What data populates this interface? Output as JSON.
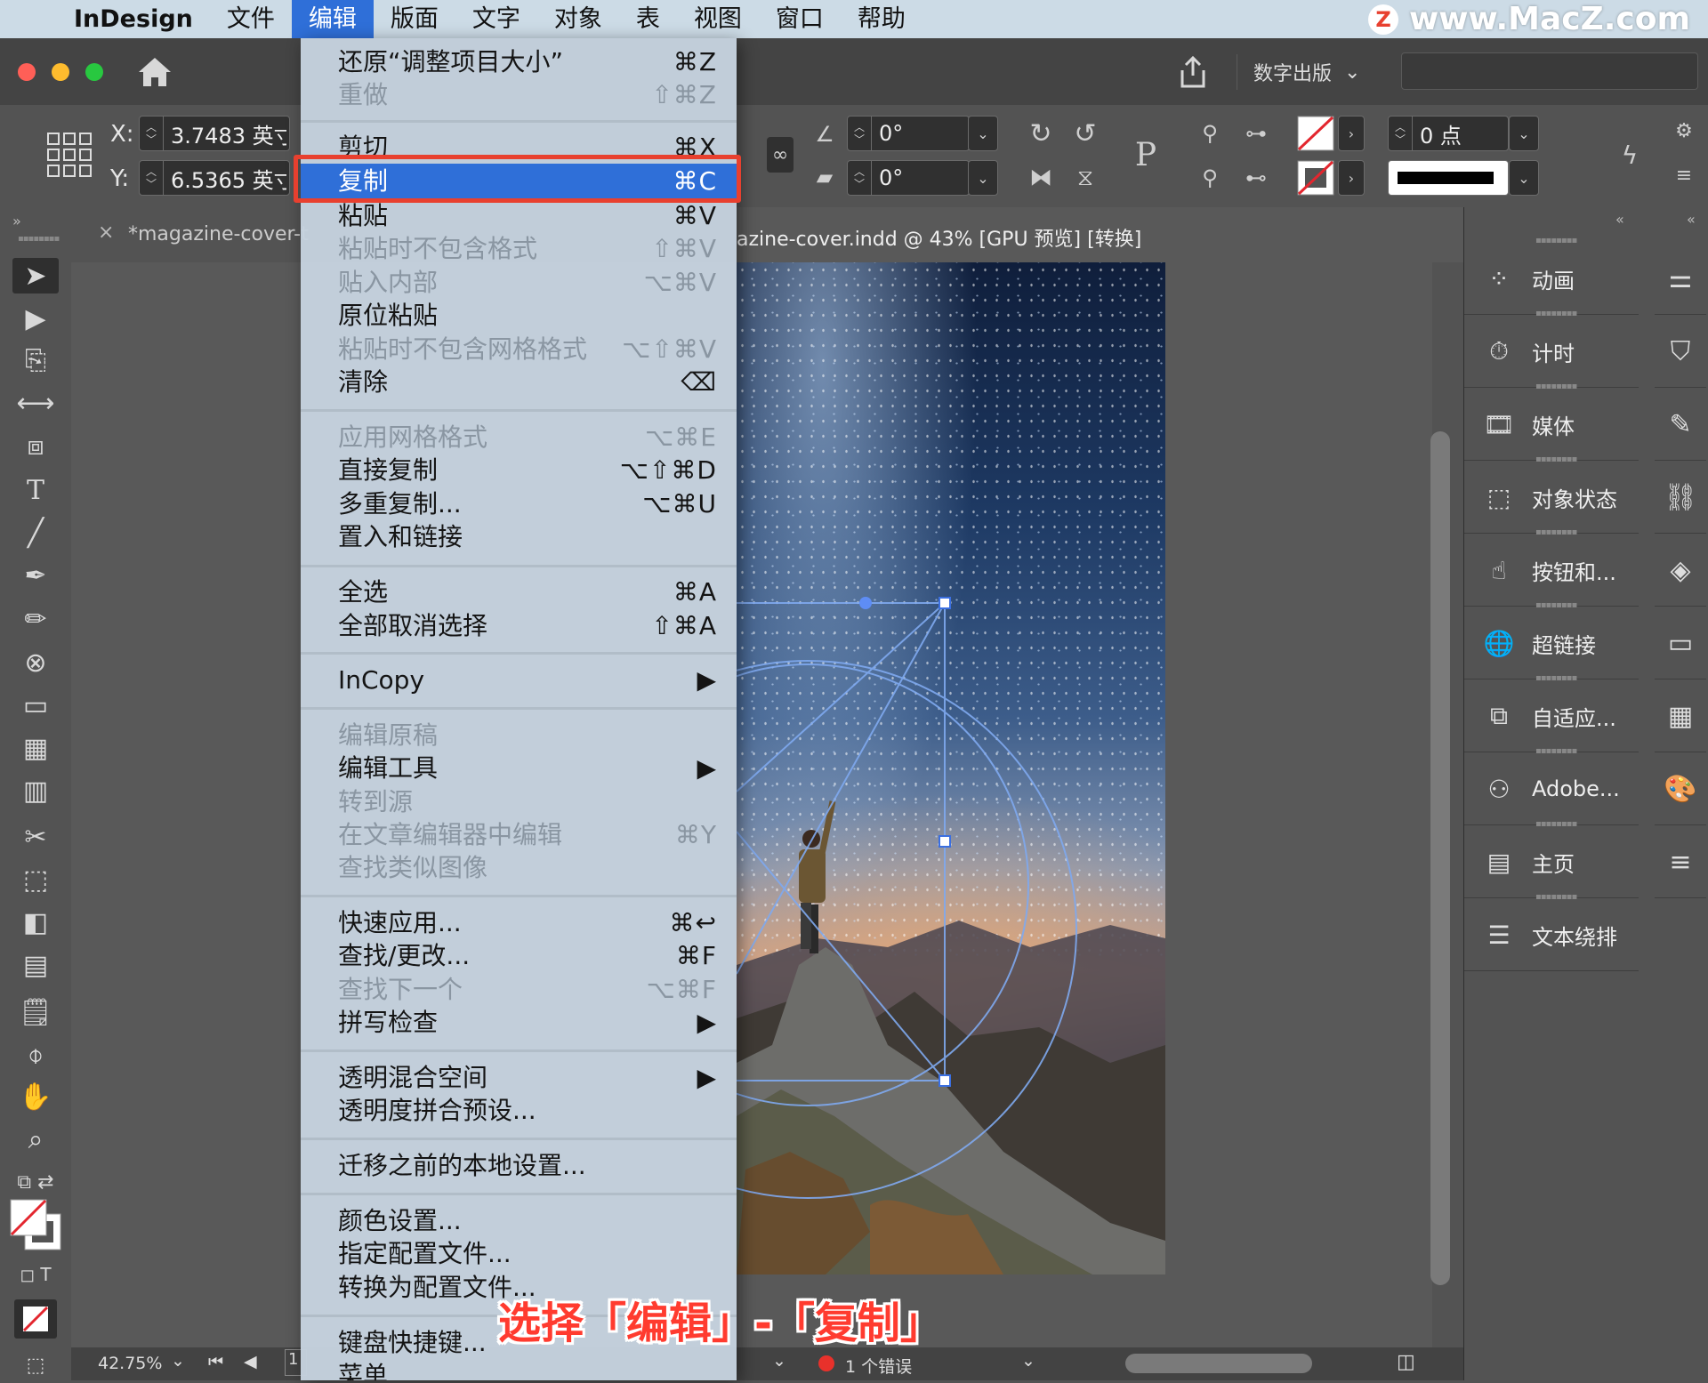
{
  "menubar": {
    "apple_icon": "",
    "app_name": "InDesign",
    "items": [
      "文件",
      "编辑",
      "版面",
      "文字",
      "对象",
      "表",
      "视图",
      "窗口",
      "帮助"
    ],
    "active_index": 1
  },
  "watermark": {
    "logo": "Z",
    "text": "www.MacZ.com"
  },
  "appbar": {
    "workspace": "数字出版"
  },
  "controlbar": {
    "x_label": "X:",
    "x_value": "3.7483 英寸",
    "y_label": "Y:",
    "y_value": "6.5365 英寸",
    "angle1": "0°",
    "angle2": "0°",
    "stroke_weight": "0 点",
    "text_frame_icon": "P"
  },
  "document": {
    "tab1": "*magazine-cover-t",
    "tab2_title": "azine-cover.indd @ 43% [GPU 预览] [转换]",
    "zoom": "42.75%",
    "page": "1",
    "errors": "1 个错误"
  },
  "panels": [
    "动画",
    "计时",
    "媒体",
    "对象状态",
    "按钮和...",
    "超链接",
    "自适应...",
    "Adobe...",
    "主页",
    "文本绕排"
  ],
  "edit_menu": {
    "items": [
      {
        "label": "还原“调整项目大小”",
        "shortcut": "⌘Z",
        "disabled": false
      },
      {
        "label": "重做",
        "shortcut": "⇧⌘Z",
        "disabled": true
      },
      {
        "label": "剪切",
        "shortcut": "⌘X",
        "disabled": false
      },
      {
        "label": "复制",
        "shortcut": "⌘C",
        "disabled": false,
        "highlighted": true
      },
      {
        "label": "粘贴",
        "shortcut": "⌘V",
        "disabled": false
      },
      {
        "label": "粘贴时不包含格式",
        "shortcut": "⇧⌘V",
        "disabled": true
      },
      {
        "label": "贴入内部",
        "shortcut": "⌥⌘V",
        "disabled": true
      },
      {
        "label": "原位粘贴",
        "shortcut": "",
        "disabled": false
      },
      {
        "label": "粘贴时不包含网格格式",
        "shortcut": "⌥⇧⌘V",
        "disabled": true
      },
      {
        "label": "清除",
        "shortcut": "⌫",
        "disabled": false
      },
      {
        "label": "应用网格格式",
        "shortcut": "⌥⌘E",
        "disabled": true
      },
      {
        "label": "直接复制",
        "shortcut": "⌥⇧⌘D",
        "disabled": false
      },
      {
        "label": "多重复制...",
        "shortcut": "⌥⌘U",
        "disabled": false
      },
      {
        "label": "置入和链接",
        "shortcut": "",
        "disabled": false
      },
      {
        "label": "全选",
        "shortcut": "⌘A",
        "disabled": false
      },
      {
        "label": "全部取消选择",
        "shortcut": "⇧⌘A",
        "disabled": false
      },
      {
        "label": "InCopy",
        "shortcut": "▶",
        "disabled": false
      },
      {
        "label": "编辑原稿",
        "shortcut": "",
        "disabled": true
      },
      {
        "label": "编辑工具",
        "shortcut": "▶",
        "disabled": false
      },
      {
        "label": "转到源",
        "shortcut": "",
        "disabled": true
      },
      {
        "label": "在文章编辑器中编辑",
        "shortcut": "⌘Y",
        "disabled": true
      },
      {
        "label": "查找类似图像",
        "shortcut": "",
        "disabled": true
      },
      {
        "label": "快速应用...",
        "shortcut": "⌘↩",
        "disabled": false
      },
      {
        "label": "查找/更改...",
        "shortcut": "⌘F",
        "disabled": false
      },
      {
        "label": "查找下一个",
        "shortcut": "⌥⌘F",
        "disabled": true
      },
      {
        "label": "拼写检查",
        "shortcut": "▶",
        "disabled": false
      },
      {
        "label": "透明混合空间",
        "shortcut": "▶",
        "disabled": false
      },
      {
        "label": "透明度拼合预设...",
        "shortcut": "",
        "disabled": false
      },
      {
        "label": "迁移之前的本地设置...",
        "shortcut": "",
        "disabled": false
      },
      {
        "label": "颜色设置...",
        "shortcut": "",
        "disabled": false
      },
      {
        "label": "指定配置文件...",
        "shortcut": "",
        "disabled": false
      },
      {
        "label": "转换为配置文件...",
        "shortcut": "",
        "disabled": false
      },
      {
        "label": "键盘快捷键...",
        "shortcut": "",
        "disabled": false
      },
      {
        "label": "菜单...",
        "shortcut": "",
        "disabled": false
      }
    ]
  },
  "caption": "选择「编辑」-「复制」",
  "colors": {
    "menu_highlight": "#2f6fd8",
    "callout_red": "#e8402f",
    "menubar_bg": "#ccdbe6"
  }
}
